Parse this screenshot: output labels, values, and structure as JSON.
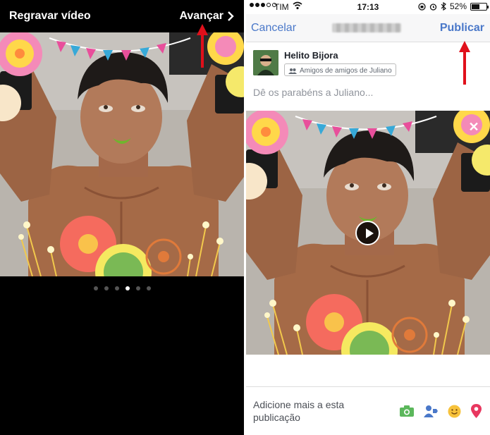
{
  "left": {
    "title": "Regravar vídeo",
    "next_label": "Avançar",
    "dots_count": 6,
    "active_dot_index": 3
  },
  "status": {
    "carrier": "TIM",
    "time": "17:13",
    "battery": "52%"
  },
  "nav": {
    "cancel_label": "Cancelar",
    "publish_label": "Publicar"
  },
  "composer": {
    "author": "Helito Bijora",
    "audience": "Amigos de amigos de Juliano",
    "placeholder": "Dê os parabéns a Juliano..."
  },
  "bottom": {
    "add_more": "Adicione mais a esta publicação"
  },
  "icons": {
    "camera": "camera-icon",
    "tag_people": "tag-people-icon",
    "feeling": "smiley-icon",
    "location": "location-pin-icon"
  },
  "colors": {
    "link_blue": "#4a78c9",
    "arrow_red": "#e0101b"
  }
}
